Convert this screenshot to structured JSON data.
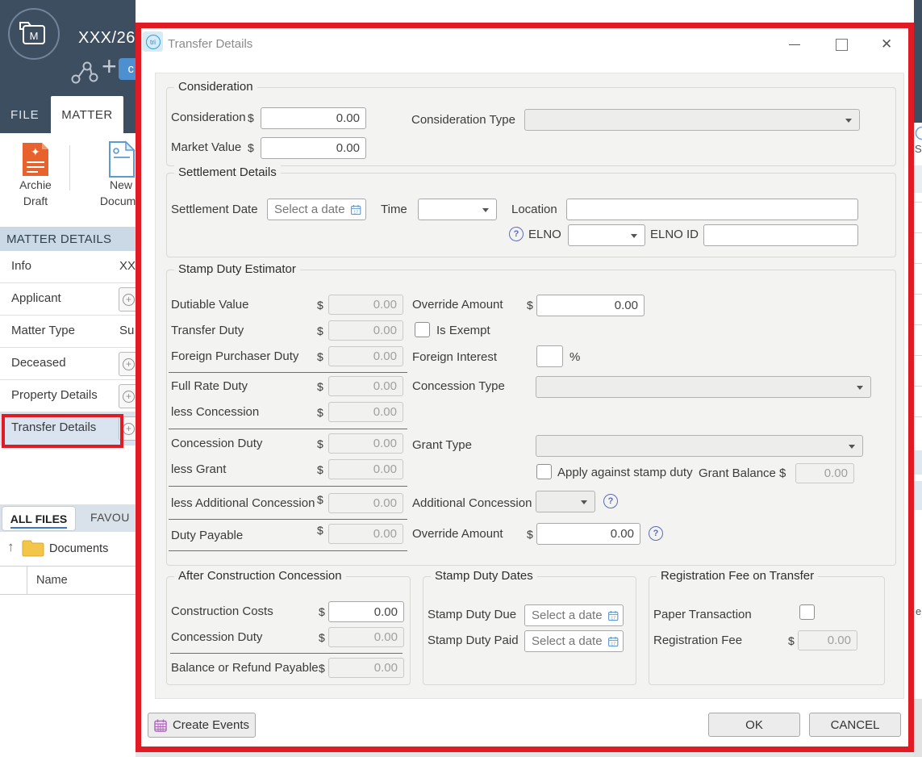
{
  "app": {
    "logo_text": "M",
    "matter_code": "XXX/26 -",
    "toolbar_button_fragment": "c",
    "tabs": {
      "file": "FILE",
      "matter": "MATTER"
    },
    "ribbon": {
      "archie_line1": "Archie",
      "archie_line2": "Draft",
      "newdoc_line1": "New",
      "newdoc_line2": "Docume"
    },
    "matter_details": {
      "header": "MATTER DETAILS",
      "items": [
        {
          "label": "Info",
          "value": "XX"
        },
        {
          "label": "Applicant",
          "value": ""
        },
        {
          "label": "Matter Type",
          "value": "Su"
        },
        {
          "label": "Deceased",
          "value": ""
        },
        {
          "label": "Property Details",
          "value": ""
        },
        {
          "label": "Transfer Details",
          "value": ""
        }
      ]
    },
    "files": {
      "tab_all_files": "ALL FILES",
      "tab_favourites": "FAVOU",
      "folder_label": "Documents",
      "column_name": "Name"
    },
    "edge": {
      "top_fragment": "Se",
      "bottom_fragment": "e"
    }
  },
  "dialog": {
    "title": "Transfer Details",
    "logo": "tri",
    "consideration": {
      "title": "Consideration",
      "consideration_label": "Consideration",
      "consideration_currency": "$",
      "consideration_value": "0.00",
      "market_value_label": "Market Value",
      "market_value_currency": "$",
      "market_value_value": "0.00",
      "type_label": "Consideration Type"
    },
    "settlement": {
      "title": "Settlement Details",
      "date_label": "Settlement Date",
      "date_placeholder": "Select a date",
      "time_label": "Time",
      "location_label": "Location",
      "elno_label": "ELNO",
      "elno_id_label": "ELNO ID"
    },
    "stamp_duty": {
      "title": "Stamp Duty Estimator",
      "currency": "$",
      "rows": [
        {
          "label": "Dutiable Value",
          "value": "0.00"
        },
        {
          "label": "Transfer Duty",
          "value": "0.00"
        },
        {
          "label": "Foreign Purchaser Duty",
          "value": "0.00"
        },
        {
          "label": "Full Rate Duty",
          "value": "0.00"
        },
        {
          "label": "less Concession",
          "value": "0.00"
        },
        {
          "label": "Concession Duty",
          "value": "0.00"
        },
        {
          "label": "less Grant",
          "value": "0.00"
        },
        {
          "label": "less Additional Concession",
          "value": "0.00"
        },
        {
          "label": "Duty Payable",
          "value": "0.00"
        }
      ],
      "override_top_label": "Override Amount",
      "override_top_value": "0.00",
      "is_exempt_label": "Is Exempt",
      "foreign_interest_label": "Foreign Interest",
      "foreign_interest_suffix": "%",
      "concession_type_label": "Concession Type",
      "grant_type_label": "Grant Type",
      "apply_against_label": "Apply against stamp duty",
      "grant_balance_label": "Grant Balance $",
      "grant_balance_value": "0.00",
      "additional_concession_label": "Additional Concession",
      "override_bottom_label": "Override Amount",
      "override_bottom_value": "0.00"
    },
    "after_construction": {
      "title": "After Construction Concession",
      "currency": "$",
      "rows": [
        {
          "label": "Construction Costs",
          "value": "0.00"
        },
        {
          "label": "Concession Duty",
          "value": "0.00"
        },
        {
          "label": "Balance or Refund Payable",
          "value": "0.00"
        }
      ]
    },
    "stamp_duty_dates": {
      "title": "Stamp Duty Dates",
      "rows": [
        {
          "label": "Stamp Duty Due",
          "placeholder": "Select a date"
        },
        {
          "label": "Stamp Duty Paid",
          "placeholder": "Select a date"
        }
      ]
    },
    "registration_fee": {
      "title": "Registration Fee on Transfer",
      "paper_label": "Paper Transaction",
      "fee_label": "Registration Fee",
      "fee_currency": "$",
      "fee_value": "0.00"
    },
    "buttons": {
      "create_events": "Create Events",
      "ok": "OK",
      "cancel": "CANCEL"
    }
  },
  "icons": {
    "close_glyph": "✕",
    "plus_glyph": "+",
    "up_arrow_glyph": "↑"
  },
  "colors": {
    "annotation_red": "#e01b24",
    "header_navy": "#3d4e61",
    "accent_blue": "#4e8fd0",
    "calendar_icon_blue": "#5b9bd5",
    "help_icon_indigo": "#5c6bc0",
    "create_events_purple": "#b45ec6",
    "matter_header_bg": "#cbd9e7",
    "selected_row_bg": "#d9e4f0"
  }
}
